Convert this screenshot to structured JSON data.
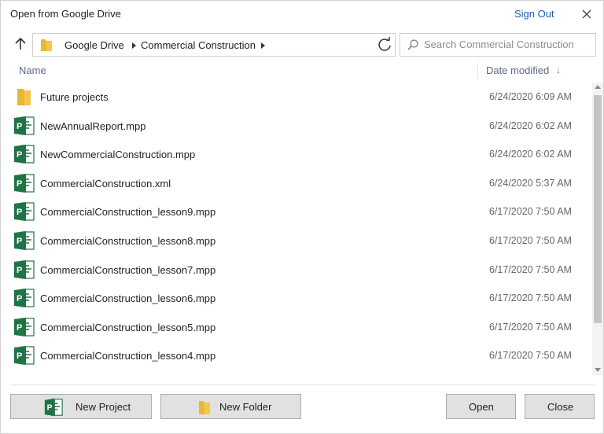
{
  "dialog": {
    "title": "Open from Google Drive",
    "sign_out": "Sign Out"
  },
  "navigation": {
    "breadcrumb": [
      "Google Drive",
      "Commercial Construction"
    ],
    "search_placeholder": "Search Commercial Construction"
  },
  "columns": {
    "name": "Name",
    "date_modified": "Date modified",
    "sort_indicator": "↓"
  },
  "files": [
    {
      "name": "Future projects",
      "date": "6/24/2020 6:09 AM",
      "type": "folder"
    },
    {
      "name": "NewAnnualReport.mpp",
      "date": "6/24/2020 6:02 AM",
      "type": "project"
    },
    {
      "name": "NewCommercialConstruction.mpp",
      "date": "6/24/2020 6:02 AM",
      "type": "project"
    },
    {
      "name": "CommercialConstruction.xml",
      "date": "6/24/2020 5:37 AM",
      "type": "project"
    },
    {
      "name": "CommercialConstruction_lesson9.mpp",
      "date": "6/17/2020 7:50 AM",
      "type": "project"
    },
    {
      "name": "CommercialConstruction_lesson8.mpp",
      "date": "6/17/2020 7:50 AM",
      "type": "project"
    },
    {
      "name": "CommercialConstruction_lesson7.mpp",
      "date": "6/17/2020 7:50 AM",
      "type": "project"
    },
    {
      "name": "CommercialConstruction_lesson6.mpp",
      "date": "6/17/2020 7:50 AM",
      "type": "project"
    },
    {
      "name": "CommercialConstruction_lesson5.mpp",
      "date": "6/17/2020 7:50 AM",
      "type": "project"
    },
    {
      "name": "CommercialConstruction_lesson4.mpp",
      "date": "6/17/2020 7:50 AM",
      "type": "project"
    }
  ],
  "buttons": {
    "new_project": "New Project",
    "new_folder": "New Folder",
    "open": "Open",
    "close": "Close"
  },
  "colors": {
    "project_icon": "#217346",
    "folder_icon": "#f3c74a",
    "link": "#1a5fb4"
  }
}
